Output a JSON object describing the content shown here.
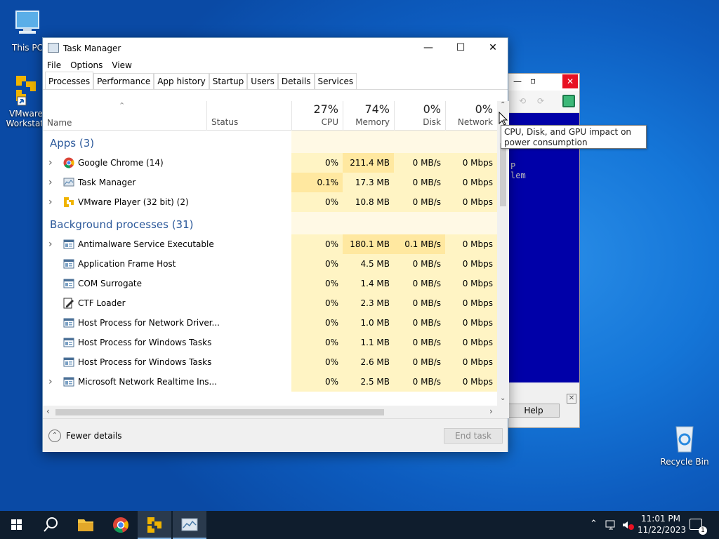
{
  "desktop": {
    "this_pc": "This PC",
    "vmware_line1": "VMware",
    "vmware_line2": "Workstati",
    "recycle_bin": "Recycle Bin"
  },
  "vmware_window": {
    "dos_line1": "P",
    "dos_line2": "lem",
    "help_label": "Help"
  },
  "task_manager": {
    "title": "Task Manager",
    "menu": [
      "File",
      "Options",
      "View"
    ],
    "tabs": [
      "Processes",
      "Performance",
      "App history",
      "Startup",
      "Users",
      "Details",
      "Services"
    ],
    "active_tab": "Processes",
    "columns": {
      "name": "Name",
      "status": "Status",
      "cpu": {
        "percent": "27%",
        "label": "CPU"
      },
      "memory": {
        "percent": "74%",
        "label": "Memory"
      },
      "disk": {
        "percent": "0%",
        "label": "Disk"
      },
      "network": {
        "percent": "0%",
        "label": "Network"
      }
    },
    "groups": {
      "apps": "Apps (3)",
      "background": "Background processes (31)"
    },
    "apps": [
      {
        "name": "Google Chrome (14)",
        "cpu": "0%",
        "memory": "211.4 MB",
        "disk": "0 MB/s",
        "network": "0 Mbps",
        "expandable": true,
        "icon": "chrome-icon"
      },
      {
        "name": "Task Manager",
        "cpu": "0.1%",
        "memory": "17.3 MB",
        "disk": "0 MB/s",
        "network": "0 Mbps",
        "expandable": true,
        "icon": "task-manager-icon"
      },
      {
        "name": "VMware Player (32 bit) (2)",
        "cpu": "0%",
        "memory": "10.8 MB",
        "disk": "0 MB/s",
        "network": "0 Mbps",
        "expandable": true,
        "icon": "vmware-icon"
      }
    ],
    "background": [
      {
        "name": "Antimalware Service Executable",
        "cpu": "0%",
        "memory": "180.1 MB",
        "disk": "0.1 MB/s",
        "network": "0 Mbps",
        "expandable": true,
        "icon": "service-icon"
      },
      {
        "name": "Application Frame Host",
        "cpu": "0%",
        "memory": "4.5 MB",
        "disk": "0 MB/s",
        "network": "0 Mbps",
        "expandable": false,
        "icon": "service-icon"
      },
      {
        "name": "COM Surrogate",
        "cpu": "0%",
        "memory": "1.4 MB",
        "disk": "0 MB/s",
        "network": "0 Mbps",
        "expandable": false,
        "icon": "service-icon"
      },
      {
        "name": "CTF Loader",
        "cpu": "0%",
        "memory": "2.3 MB",
        "disk": "0 MB/s",
        "network": "0 Mbps",
        "expandable": false,
        "icon": "ctf-icon"
      },
      {
        "name": "Host Process for Network Driver...",
        "cpu": "0%",
        "memory": "1.0 MB",
        "disk": "0 MB/s",
        "network": "0 Mbps",
        "expandable": false,
        "icon": "service-icon"
      },
      {
        "name": "Host Process for Windows Tasks",
        "cpu": "0%",
        "memory": "1.1 MB",
        "disk": "0 MB/s",
        "network": "0 Mbps",
        "expandable": false,
        "icon": "service-icon"
      },
      {
        "name": "Host Process for Windows Tasks",
        "cpu": "0%",
        "memory": "2.6 MB",
        "disk": "0 MB/s",
        "network": "0 Mbps",
        "expandable": false,
        "icon": "service-icon"
      },
      {
        "name": "Microsoft Network Realtime Ins...",
        "cpu": "0%",
        "memory": "2.5 MB",
        "disk": "0 MB/s",
        "network": "0 Mbps",
        "expandable": true,
        "icon": "service-icon"
      }
    ],
    "tooltip": "CPU, Disk, and GPU impact on power consumption",
    "fewer_details": "Fewer details",
    "end_task": "End task"
  },
  "taskbar": {
    "time": "11:01 PM",
    "date": "11/22/2023",
    "notification_count": "1"
  },
  "colors": {
    "heat_light": "#fff4c4",
    "heat_mid": "#ffe8a0",
    "heat_empty": "#fff9e5",
    "accent_group": "#2d5a9b",
    "taskbar": "#0f1d2d"
  }
}
